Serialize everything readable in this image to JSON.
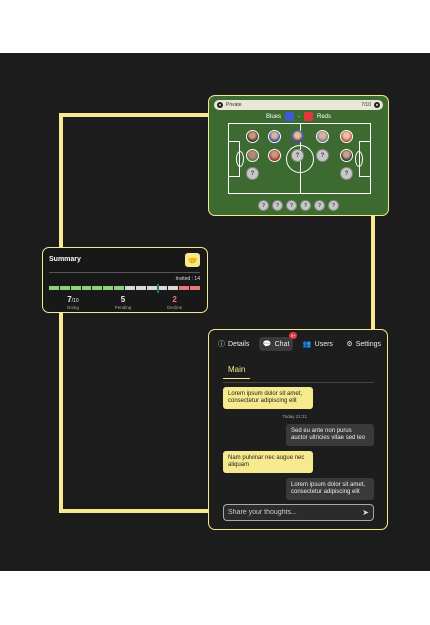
{
  "colors": {
    "accent": "#f7e98e",
    "background": "#1c1c1c",
    "pitch": "#3d6a31",
    "blues": "#3b5bd9",
    "reds": "#e03a3e",
    "going": "#8fd37e",
    "pending": "#d8d8d8",
    "decline": "#e87979"
  },
  "pitch": {
    "visibility": "Private",
    "count": "7/10",
    "team_a": "Blues",
    "team_b": "Reds",
    "separator": "-",
    "empty_slot": "?",
    "subs": [
      "?",
      "?",
      "?",
      "?",
      "?",
      "?"
    ]
  },
  "summary": {
    "title": "Summary",
    "button_icon": "handshake-icon",
    "invited": "Invited : 14",
    "going": "7",
    "going_total": "/10",
    "going_label": "Going",
    "pending": "5",
    "pending_label": "Pending",
    "decline": "2",
    "decline_label": "Decline"
  },
  "chat": {
    "tabs": [
      {
        "label": "Details",
        "icon": "info-icon"
      },
      {
        "label": "Chat",
        "icon": "chat-icon",
        "badge": "9+"
      },
      {
        "label": "Users",
        "icon": "users-icon"
      },
      {
        "label": "Settings",
        "icon": "sliders-icon"
      }
    ],
    "channel": "Main",
    "messages": [
      {
        "side": "left",
        "text": "Lorem ipsum dolor sit amet, consectetur adipiscing elit"
      },
      {
        "side": "right",
        "time": "Today 21:21",
        "text": "Sed eu ante non purus auctor ultricies vitae sed leo"
      },
      {
        "side": "left",
        "text": "Nam pulvinar nec augue nec aliquam"
      },
      {
        "side": "right",
        "text": "Lorem ipsum dolor sit amet, consectetur adipiscing elit"
      }
    ],
    "placeholder": "Share your thoughts..."
  }
}
